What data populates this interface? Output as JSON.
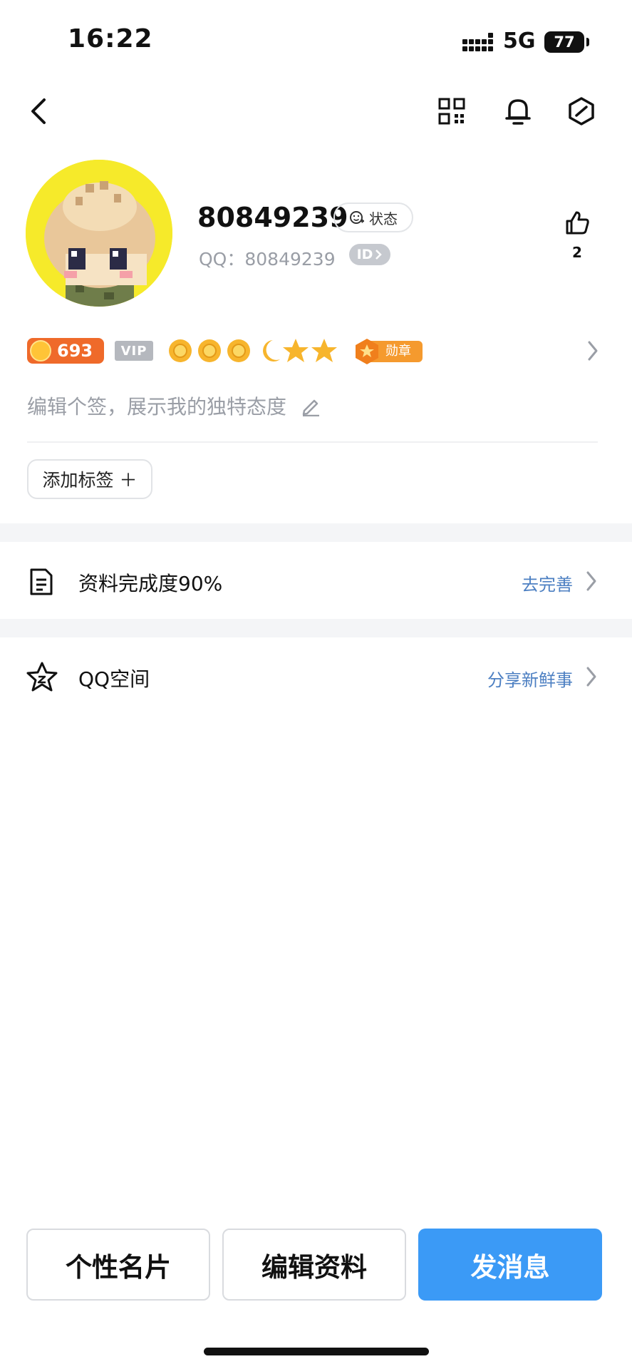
{
  "status_bar": {
    "time": "16:22",
    "network": "5G",
    "battery": "77"
  },
  "profile": {
    "nickname": "80849239",
    "status_label": "状态",
    "qq_label": "QQ：",
    "qq_number": "80849239",
    "id_badge": "ID",
    "like_count": "2",
    "coin_level": "693",
    "vip_label": "VIP",
    "medal_label": "勋章",
    "signature_placeholder": "编辑个签，展示我的独特态度",
    "add_tag_label": "添加标签 ＋"
  },
  "rows": {
    "completion": {
      "title": "资料完成度90%",
      "action": "去完善"
    },
    "qzone": {
      "title": "QQ空间",
      "action": "分享新鲜事"
    }
  },
  "buttons": {
    "card": "个性名片",
    "edit": "编辑资料",
    "message": "发消息"
  },
  "icons": {
    "back": "chevron-left-icon",
    "qr": "qr-code-icon",
    "bell": "bell-icon",
    "settings": "hexagon-slash-icon",
    "like": "thumbs-up-icon",
    "edit": "pencil-icon",
    "doc": "document-icon",
    "star": "star-icon",
    "chevron": "chevron-right-icon"
  },
  "colors": {
    "accent": "#3b9af6",
    "link": "#4c7fc2",
    "coin": "#ef6a2a",
    "medal": "#f59a2e",
    "avatar_bg": "#f6ea2a"
  }
}
